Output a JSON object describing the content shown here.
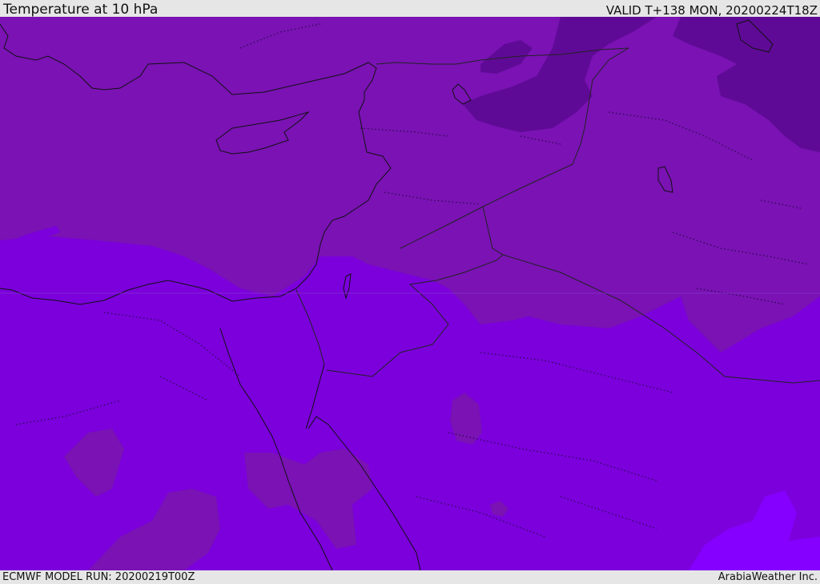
{
  "header": {
    "title": "Temperature at 10 hPa",
    "valid_time": "VALID T+138 MON, 20200224T18Z"
  },
  "footer": {
    "model_run": "ECMWF MODEL RUN: 20200219T00Z",
    "credit": "ArabiaWeather Inc."
  },
  "map": {
    "region": "Eastern Mediterranean / Middle East",
    "field": "temperature shading",
    "colors": {
      "warmest_band": "#7a12b4",
      "mid_band": "#7b00dc",
      "coldest_band": "#5f0a96",
      "light_band": "#8500ff",
      "coastline": "#111111",
      "border": "#222222"
    }
  }
}
